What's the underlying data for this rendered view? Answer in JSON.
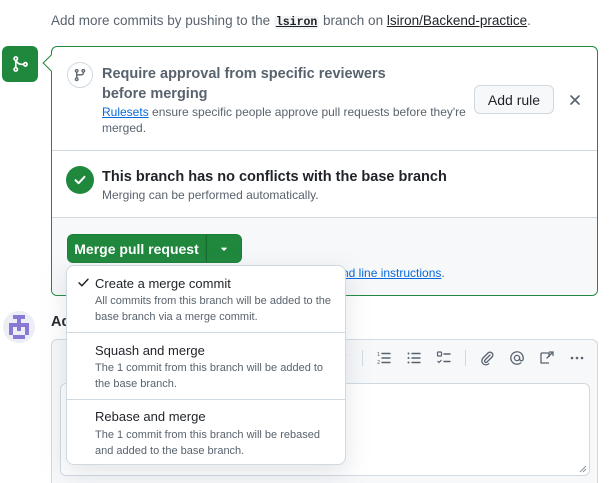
{
  "hint": {
    "prefix": "Add more commits by pushing to the ",
    "branch": "lsiron",
    "middle": " branch on ",
    "repo": "lsiron/Backend-practice",
    "suffix": "."
  },
  "reviewers": {
    "title": "Require approval from specific reviewers before merging",
    "link": "Rulesets",
    "desc": " ensure specific people approve pull requests before they're merged.",
    "add_rule": "Add rule"
  },
  "conflicts": {
    "title": "This branch has no conflicts with the base branch",
    "desc": "Merging can be performed automatically."
  },
  "merge": {
    "button": "Merge pull request",
    "cli_tail": "nd line instructions",
    "cli_dot": "."
  },
  "comment": {
    "label_partial": "Ad"
  },
  "menu": {
    "items": [
      {
        "label": "Create a merge commit",
        "desc": "All commits from this branch will be added to the base branch via a merge commit.",
        "selected": true
      },
      {
        "label": "Squash and merge",
        "desc": "The 1 commit from this branch will be added to the base branch.",
        "selected": false
      },
      {
        "label": "Rebase and merge",
        "desc": "The 1 commit from this branch will be rebased and added to the base branch.",
        "selected": false
      }
    ]
  },
  "colors": {
    "accent_green": "#1f883d",
    "link_blue": "#0969da",
    "muted_text": "#59636e",
    "border": "#d1d9e0"
  },
  "icons": [
    "git-merge-icon",
    "git-branch-icon",
    "close-icon",
    "check-circle-icon",
    "triangle-down-icon",
    "check-icon",
    "link-icon",
    "numbered-list-icon",
    "bullet-list-icon",
    "task-list-icon",
    "paperclip-icon",
    "mention-icon",
    "cross-reference-icon",
    "more-icon"
  ]
}
